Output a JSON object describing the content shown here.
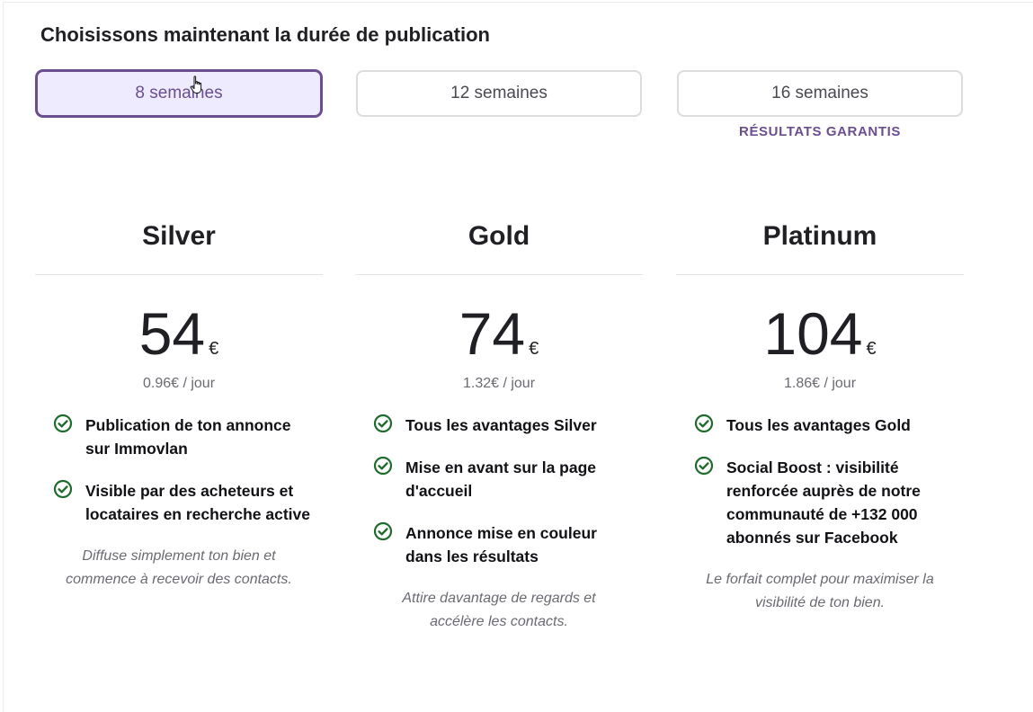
{
  "page_title": "Choisissons maintenant la durée de publication",
  "durations": [
    {
      "label": "8 semaines",
      "selected": true
    },
    {
      "label": "12 semaines",
      "selected": false
    },
    {
      "label": "16 semaines",
      "selected": false
    }
  ],
  "guarantee_badge": "RÉSULTATS GARANTIS",
  "plans": [
    {
      "name": "Silver",
      "price": "54",
      "currency": "€",
      "per_day": "0.96€ / jour",
      "features": [
        "Publication de ton annonce sur Immovlan",
        "Visible par des acheteurs et locataires en recherche active"
      ],
      "tagline": "Diffuse simplement ton bien et commence à recevoir des contacts."
    },
    {
      "name": "Gold",
      "price": "74",
      "currency": "€",
      "per_day": "1.32€ / jour",
      "features": [
        "Tous les avantages Silver",
        "Mise en avant sur la page d'accueil",
        "Annonce mise en couleur dans les résultats"
      ],
      "tagline": "Attire davantage de regards et accélère les contacts."
    },
    {
      "name": "Platinum",
      "price": "104",
      "currency": "€",
      "per_day": "1.86€ / jour",
      "features": [
        "Tous les avantages Gold",
        "Social Boost : visibilité renforcée auprès de notre communauté de +132 000 abonnés sur Facebook"
      ],
      "tagline": "Le forfait complet pour maximiser la visibilité de ton bien."
    }
  ],
  "colors": {
    "accent": "#6b4e8f",
    "selected_bg": "#efebff",
    "check": "#1e6b2c"
  },
  "icons": {
    "feature": "check-circle-icon",
    "pointer": "hand-pointer-icon"
  }
}
